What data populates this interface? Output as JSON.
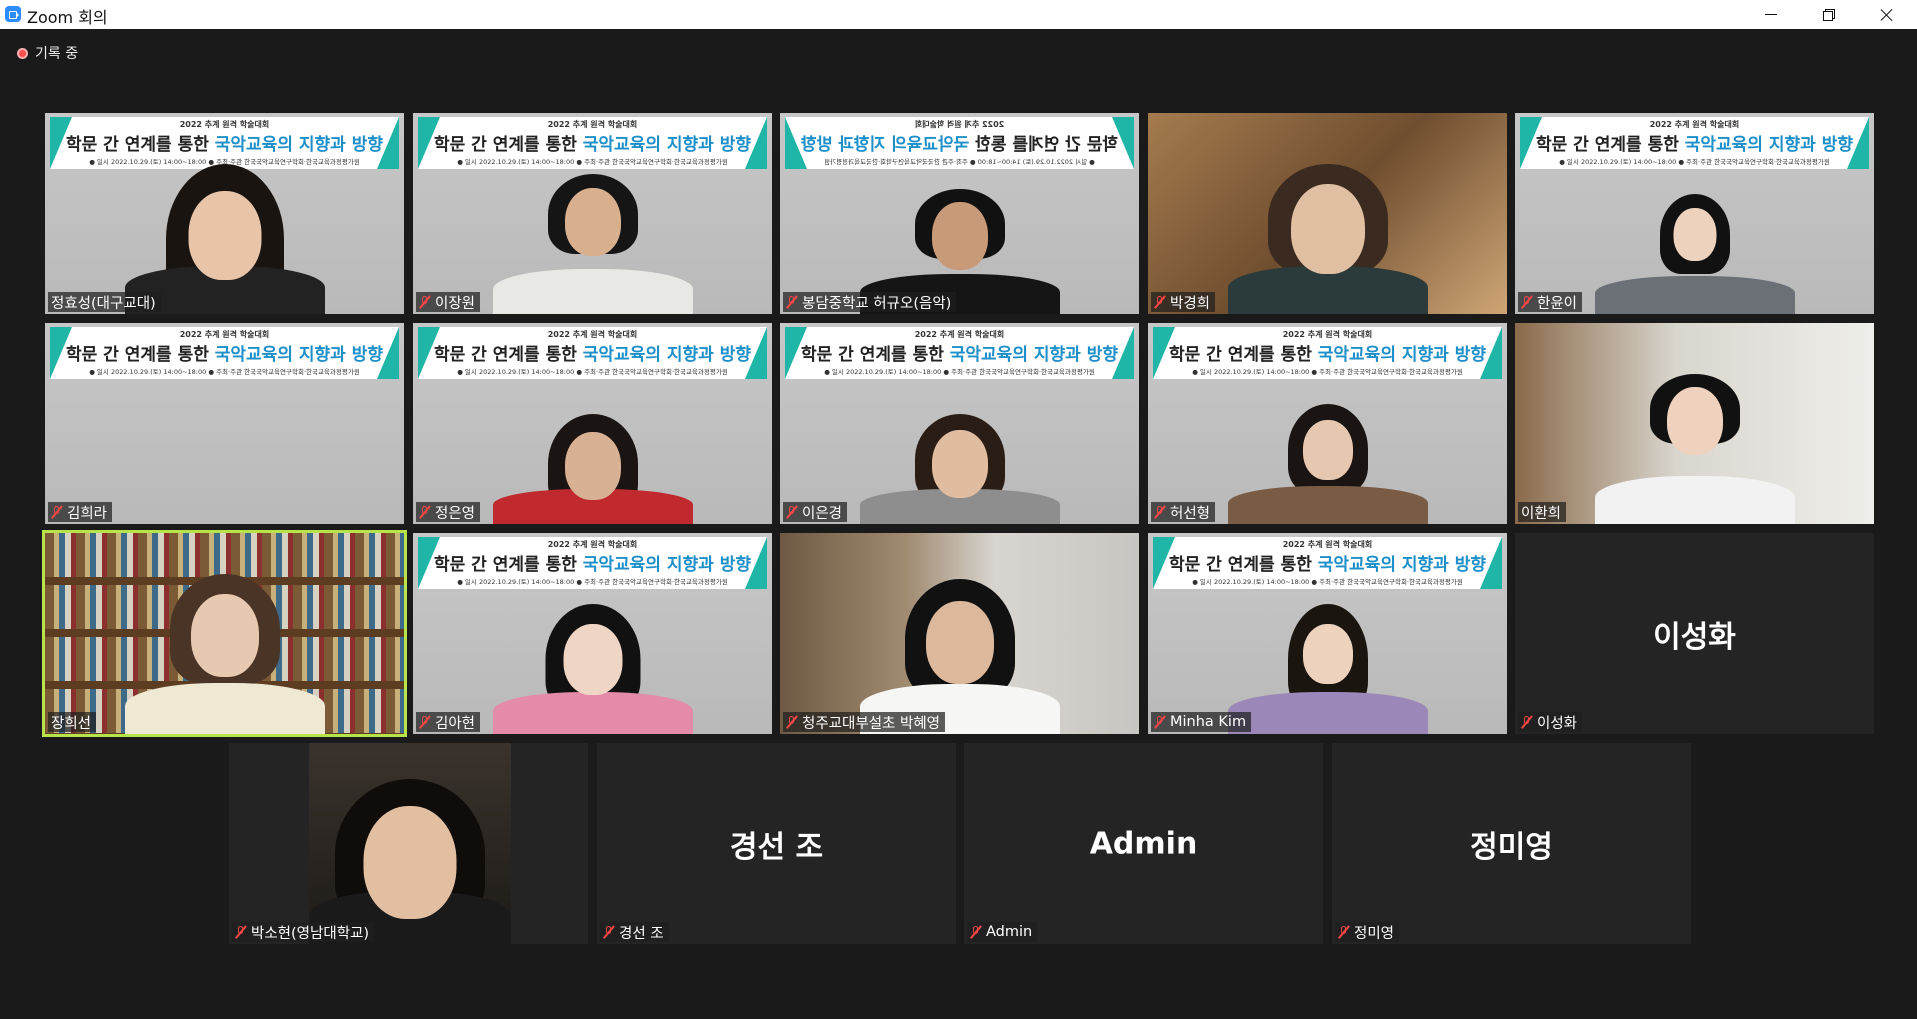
{
  "window": {
    "title": "Zoom 회의"
  },
  "recording": {
    "label": "기록 중"
  },
  "banner": {
    "top": "2022 추계 원격 학술대회",
    "main_prefix": "학문 간 연계를 통한 ",
    "main_highlight": "국악교육의 지향과 방향",
    "sub": "● 일시 2022.10.29.(토) 14:00~18:00   ● 주최·주관 한국국악교육연구학회·한국교육과정평가원"
  },
  "participants": [
    {
      "name": "정효성(대구교대)",
      "muted": false,
      "active": false,
      "video": "banner"
    },
    {
      "name": "이장원",
      "muted": true,
      "active": false,
      "video": "banner"
    },
    {
      "name": "봉담중학교 허규오(음악)",
      "muted": true,
      "active": false,
      "video": "banner-mirror"
    },
    {
      "name": "박경희",
      "muted": true,
      "active": false,
      "video": "room"
    },
    {
      "name": "한윤이",
      "muted": true,
      "active": false,
      "video": "banner"
    },
    {
      "name": "김희라",
      "muted": true,
      "active": false,
      "video": "banner"
    },
    {
      "name": "정은영",
      "muted": true,
      "active": false,
      "video": "banner"
    },
    {
      "name": "이은경",
      "muted": true,
      "active": false,
      "video": "banner"
    },
    {
      "name": "허선형",
      "muted": true,
      "active": false,
      "video": "banner"
    },
    {
      "name": "이환희",
      "muted": false,
      "active": false,
      "video": "office"
    },
    {
      "name": "장희선",
      "muted": false,
      "active": true,
      "video": "shelf"
    },
    {
      "name": "김아현",
      "muted": true,
      "active": false,
      "video": "banner"
    },
    {
      "name": "청주교대부설초 박혜영",
      "muted": true,
      "active": false,
      "video": "hall"
    },
    {
      "name": "Minha Kim",
      "muted": true,
      "active": false,
      "video": "banner"
    },
    {
      "name": "이성화",
      "muted": true,
      "active": false,
      "video": "off",
      "display_name": "이성화"
    },
    {
      "name": "박소현(영남대학교)",
      "muted": true,
      "active": false,
      "video": "portrait"
    },
    {
      "name": "경선 조",
      "muted": true,
      "active": false,
      "video": "off",
      "display_name": "경선 조"
    },
    {
      "name": "Admin",
      "muted": true,
      "active": false,
      "video": "off",
      "display_name": "Admin"
    },
    {
      "name": "정미영",
      "muted": true,
      "active": false,
      "video": "off",
      "display_name": "정미영"
    }
  ],
  "colors": {
    "active_speaker": "#b8e34a",
    "muted_red": "#ff4646",
    "banner_teal": "#1fb6a8"
  }
}
